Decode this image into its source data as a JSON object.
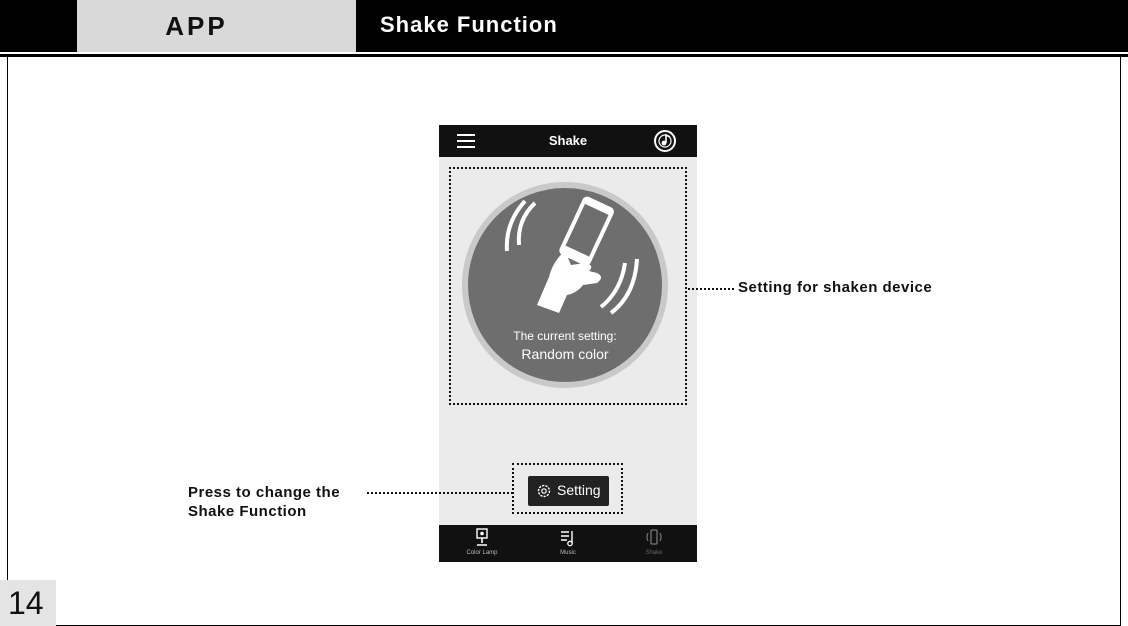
{
  "header": {
    "app_tab": "APP",
    "section_title": "Shake Function"
  },
  "phone": {
    "title": "Shake",
    "current_setting_label": "The current setting:",
    "current_setting_value": "Random color",
    "setting_button": "Setting",
    "tabs": [
      {
        "label": "Color Lamp",
        "icon": "lamp-icon"
      },
      {
        "label": "Music",
        "icon": "music-icon"
      },
      {
        "label": "Shake",
        "icon": "shake-icon"
      }
    ]
  },
  "callouts": {
    "shaken_device": "Setting for shaken device",
    "change_function_line1": "Press to change the",
    "change_function_line2": "Shake Function"
  },
  "page_number": "14",
  "colors": {
    "header": "#000000",
    "tab_bg": "#d9d9d9",
    "circle": "#6e6e6e",
    "phone_bg": "#ebebeb"
  }
}
